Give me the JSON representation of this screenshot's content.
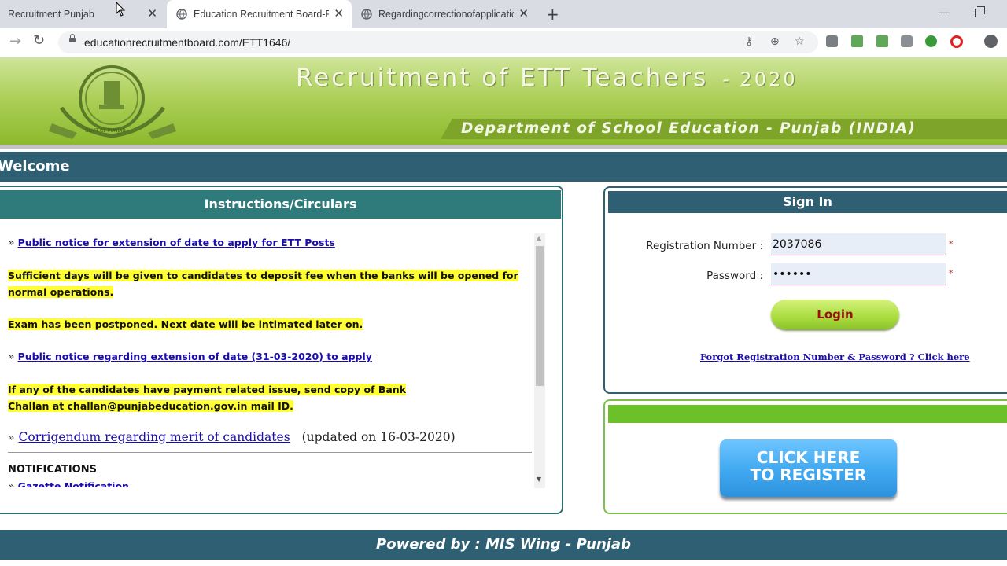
{
  "browser": {
    "tabs": [
      {
        "title": "Recruitment Punjab",
        "close": "✕"
      },
      {
        "title": "Education Recruitment Board-Punjab",
        "close": "✕"
      },
      {
        "title": "Regardingcorrectionofapplication",
        "close": "✕"
      }
    ],
    "new_tab": "+",
    "minimize": "—",
    "url": "educationrecruitmentboard.com/ETT1646/",
    "forward": "→",
    "reload": "↻",
    "key_icon": "⚷",
    "zoom_icon": "⊕",
    "star_icon": "☆"
  },
  "banner": {
    "title": "Recruitment of ETT Teachers",
    "year": "- 2020",
    "subtitle": "Department of School Education - Punjab (INDIA)",
    "emblem_text": "GOVT OF PUNJAB"
  },
  "welcome": "Welcome",
  "instructions": {
    "header": "Instructions/Circulars",
    "raquo": "»",
    "items": [
      {
        "link": "Public notice for extension of date to apply for ETT Posts"
      },
      {
        "text": "Sufficient days will be given to candidates to deposit fee when the banks will be opened for normal operations."
      },
      {
        "text": "Exam has been postponed. Next date will be intimated later on."
      },
      {
        "link": "Public notice regarding extension of date (31-03-2020) to apply"
      },
      {
        "text": "If any of the candidates have payment related issue, send copy of Bank Challan at challan@punjabeducation.gov.in mail ID."
      },
      {
        "link": "Corrigendum regarding merit of candidates",
        "note": "(updated on 16-03-2020)"
      }
    ],
    "notifications_heading": "NOTIFICATIONS",
    "notifications": [
      {
        "link": "Gazette Notification"
      }
    ]
  },
  "signin": {
    "header": "Sign In",
    "reg_label": "Registration Number :",
    "reg_value": "2037086",
    "pwd_label": "Password :",
    "pwd_value": "••••••",
    "required": "*",
    "login": "Login",
    "forgot": "Forgot Registration Number & Password ? Click here"
  },
  "register": {
    "button": "CLICK HERE\nTO REGISTER"
  },
  "footer": "Powered by : MIS Wing - Punjab",
  "colors": {
    "header_blue": "#2f5f73",
    "teal": "#2f7a7a",
    "banner_green": "#aed05a",
    "highlight": "#ffff33",
    "link": "#1a0dab"
  }
}
